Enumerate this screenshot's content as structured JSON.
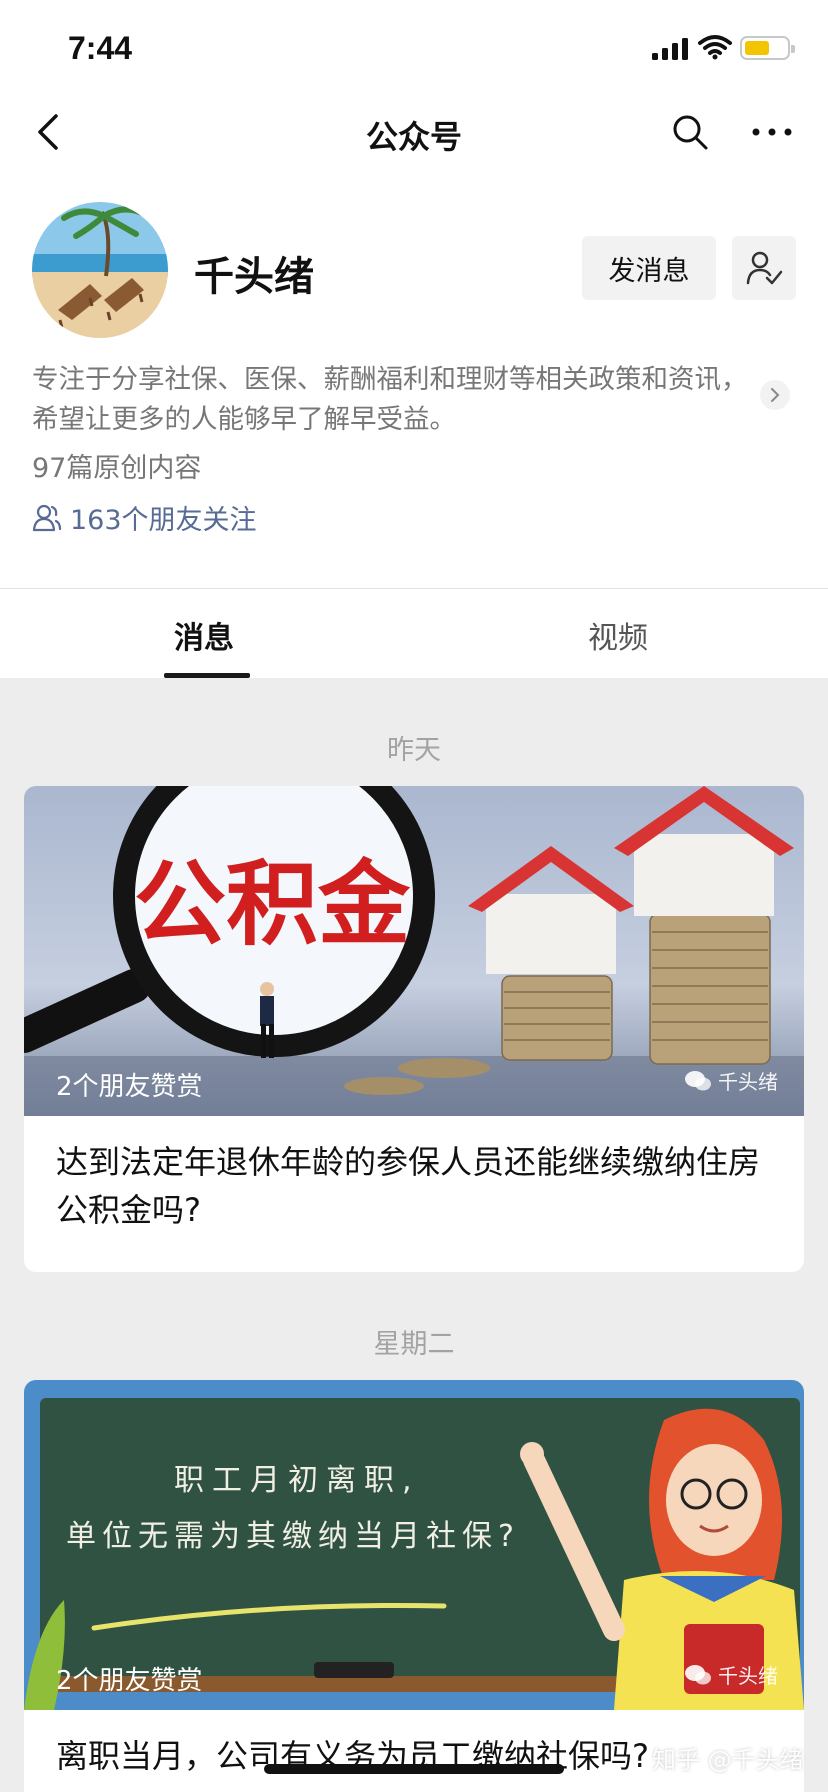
{
  "status_bar": {
    "time": "7:44"
  },
  "nav": {
    "title": "公众号"
  },
  "account": {
    "name": "千头绪",
    "send_message_label": "发消息",
    "description": "专注于分享社保、医保、薪酬福利和理财等相关政策和资讯，希望让更多的人能够早了解早受益。",
    "original_count": "97篇原创内容",
    "friends_following": "163个朋友关注"
  },
  "tabs": {
    "messages": "消息",
    "video": "视频"
  },
  "feed": [
    {
      "date": "昨天",
      "image_text": "公积金",
      "friends_liked": "2个朋友赞赏",
      "watermark": "千头绪",
      "title": "达到法定年退休年龄的参保人员还能继续缴纳住房公积金吗?"
    },
    {
      "date": "星期二",
      "image_text_line1": "职工月初离职,",
      "image_text_line2": "单位无需为其缴纳当月社保?",
      "friends_liked": "2个朋友赞赏",
      "watermark": "千头绪",
      "title": "离职当月，公司有义务为员工缴纳社保吗?"
    }
  ],
  "overlay": {
    "zhihu_watermark": "知乎 @千头绪"
  },
  "colors": {
    "link_blue": "#576b95",
    "background": "#ededed",
    "accent_red": "#d42a2a",
    "battery_yellow": "#f5c400"
  }
}
